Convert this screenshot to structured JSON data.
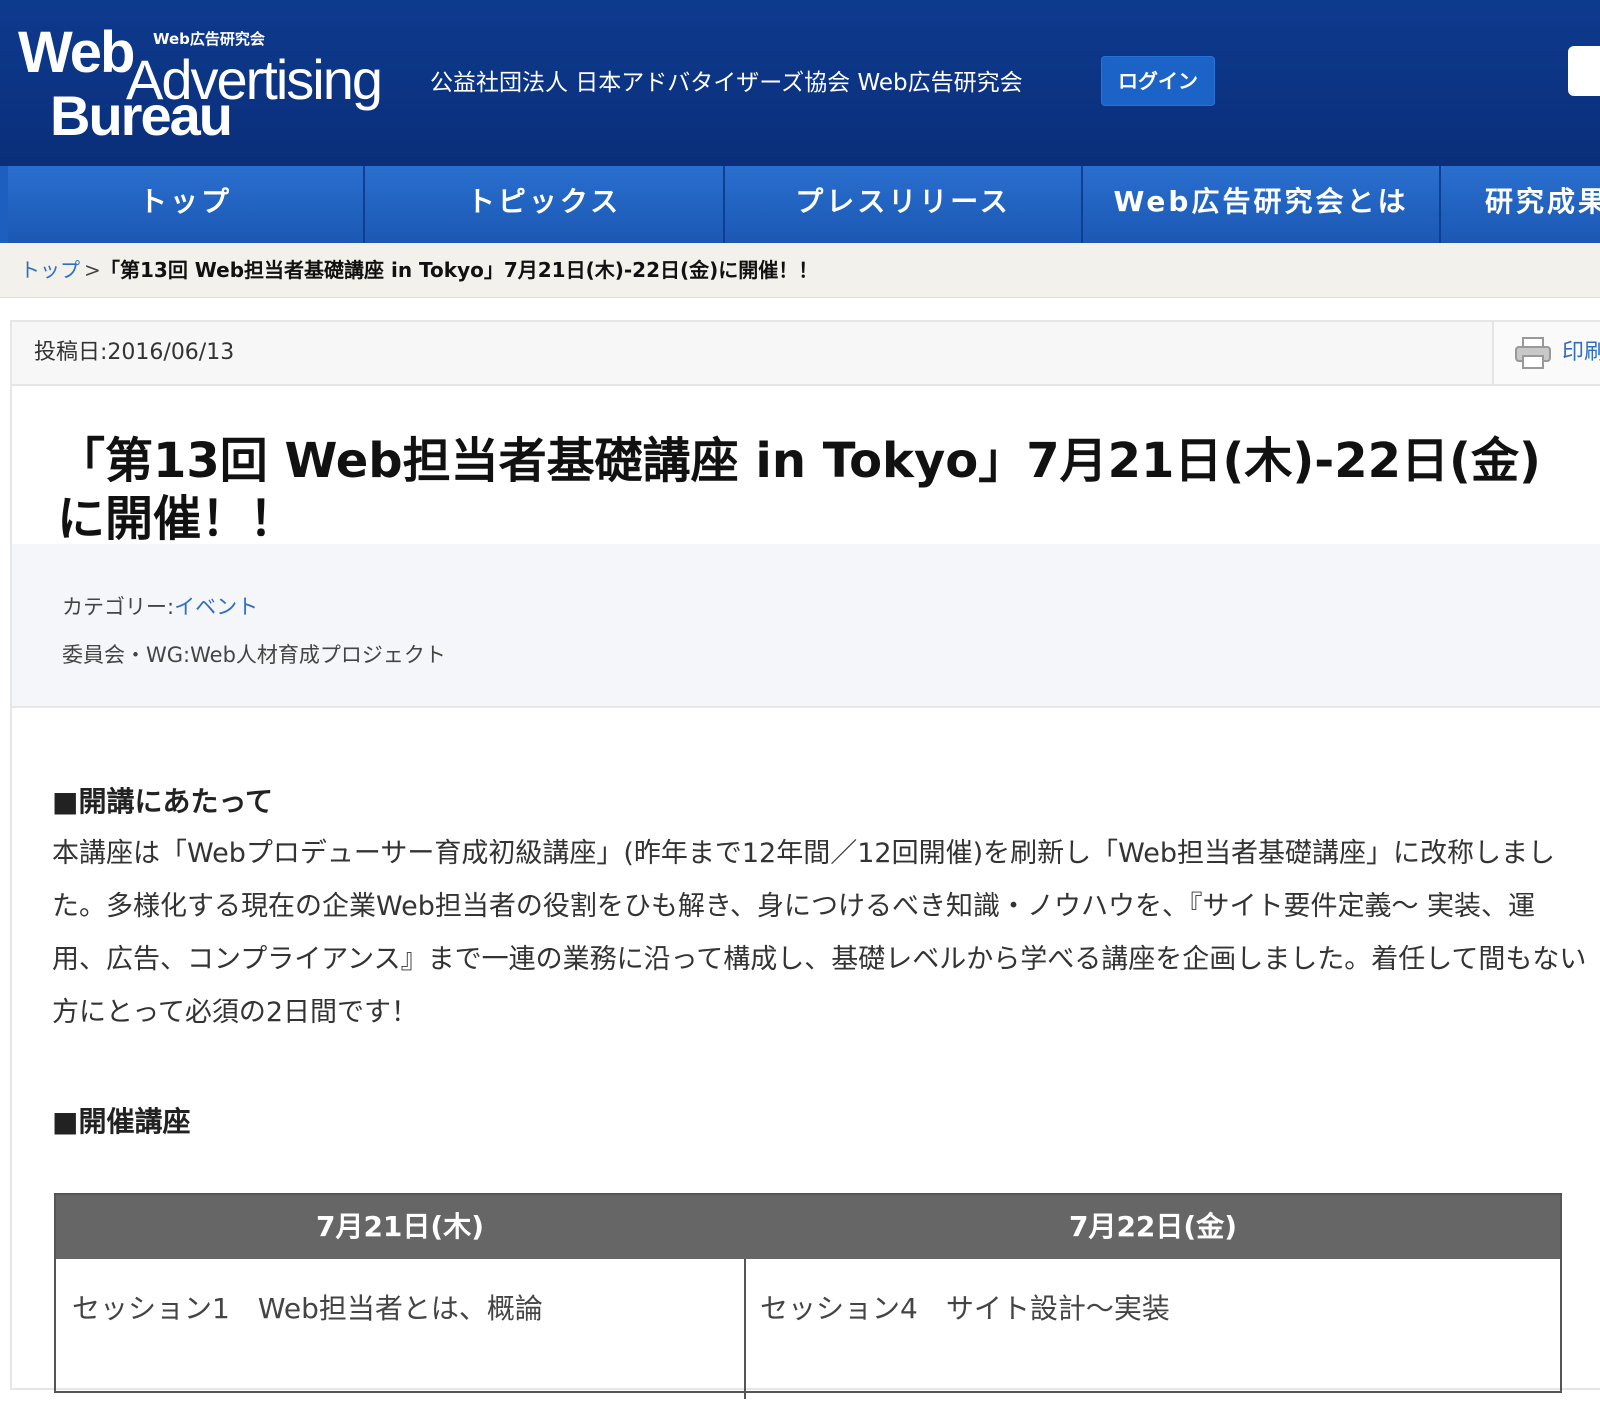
{
  "header": {
    "logo_line1": "Web",
    "logo_line2": "Advertising",
    "logo_line3": "Bureau",
    "logo_small": "Web広告研究会",
    "org_name": "公益社団法人 日本アドバタイザーズ協会 Web広告研究会",
    "login_label": "ログイン"
  },
  "nav": {
    "items": [
      "トップ",
      "トピックス",
      "プレスリリース",
      "Web広告研究会とは",
      "研究成果"
    ]
  },
  "breadcrumb": {
    "top": "トップ",
    "separator": ">",
    "current": "「第13回 Web担当者基礎講座 in Tokyo」7月21日(木)-22日(金)に開催！！"
  },
  "article": {
    "post_date": "投稿日:2016/06/13",
    "print_label": "印刷",
    "title": "「第13回 Web担当者基礎講座 in Tokyo」7月21日(木)-22日(金)に開催！！",
    "category_label": "カテゴリー:",
    "category_value": "イベント",
    "committee": "委員会・WG:Web人材育成プロジェクト",
    "section1_heading": "■開講にあたって",
    "section1_body": "本講座は「Webプロデューサー育成初級講座」(昨年まで12年間／12回開催)を刷新し「Web担当者基礎講座」に改称しました。多様化する現在の企業Web担当者の役割をひも解き、身につけるべき知識・ノウハウを、『サイト要件定義～ 実装、運用、広告、コンプライアンス』まで一連の業務に沿って構成し、基礎レベルから学べる講座を企画しました。着任して間もない方にとって必須の2日間です！",
    "section2_heading": "■開催講座",
    "schedule": {
      "day1": "7月21日(木)",
      "day2": "7月22日(金)",
      "day1_session": "セッション1　Web担当者とは、概論",
      "day2_session": "セッション4　サイト設計～実装"
    }
  }
}
